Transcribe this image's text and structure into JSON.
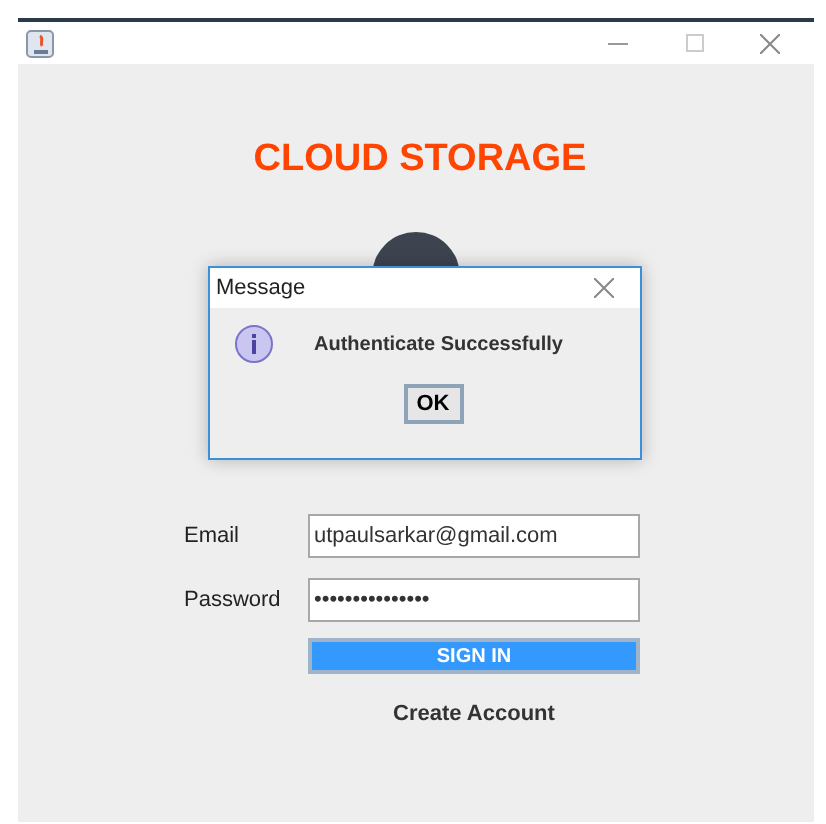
{
  "app_title": "CLOUD STORAGE",
  "form": {
    "fields": [
      {
        "label": "Email",
        "value": "utpaulsarkar@gmail.com"
      },
      {
        "label": "Password",
        "value": "•••••••••••••••"
      }
    ],
    "submit": "SIGN IN",
    "link": "Create Account"
  },
  "dialog": {
    "title": "Message",
    "message": "Authenticate Successfully",
    "button": "OK"
  }
}
